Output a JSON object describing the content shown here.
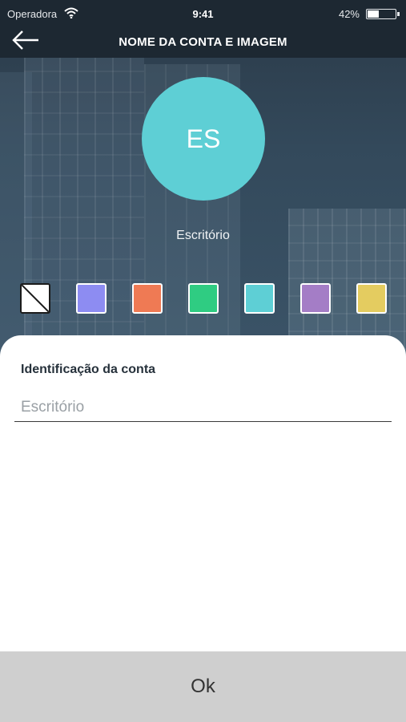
{
  "status_bar": {
    "carrier": "Operadora",
    "time": "9:41",
    "battery_pct": "42%",
    "battery_level": 0.42
  },
  "header": {
    "title": "NOME DA CONTA E IMAGEM",
    "back_icon": "arrow-left-icon"
  },
  "avatar": {
    "initials": "ES",
    "color": "#5ecfd5"
  },
  "account_name": "Escritório",
  "swatches": [
    {
      "name": "none",
      "color": "none"
    },
    {
      "name": "purple-blue",
      "color": "#8d8cf2"
    },
    {
      "name": "orange",
      "color": "#ef7a54"
    },
    {
      "name": "green",
      "color": "#2fcc82"
    },
    {
      "name": "cyan",
      "color": "#5ecfd5"
    },
    {
      "name": "purple",
      "color": "#a47dc6"
    },
    {
      "name": "yellow",
      "color": "#e4cc60"
    }
  ],
  "form": {
    "label": "Identificação da conta",
    "placeholder": "Escritório",
    "value": ""
  },
  "ok_label": "Ok"
}
